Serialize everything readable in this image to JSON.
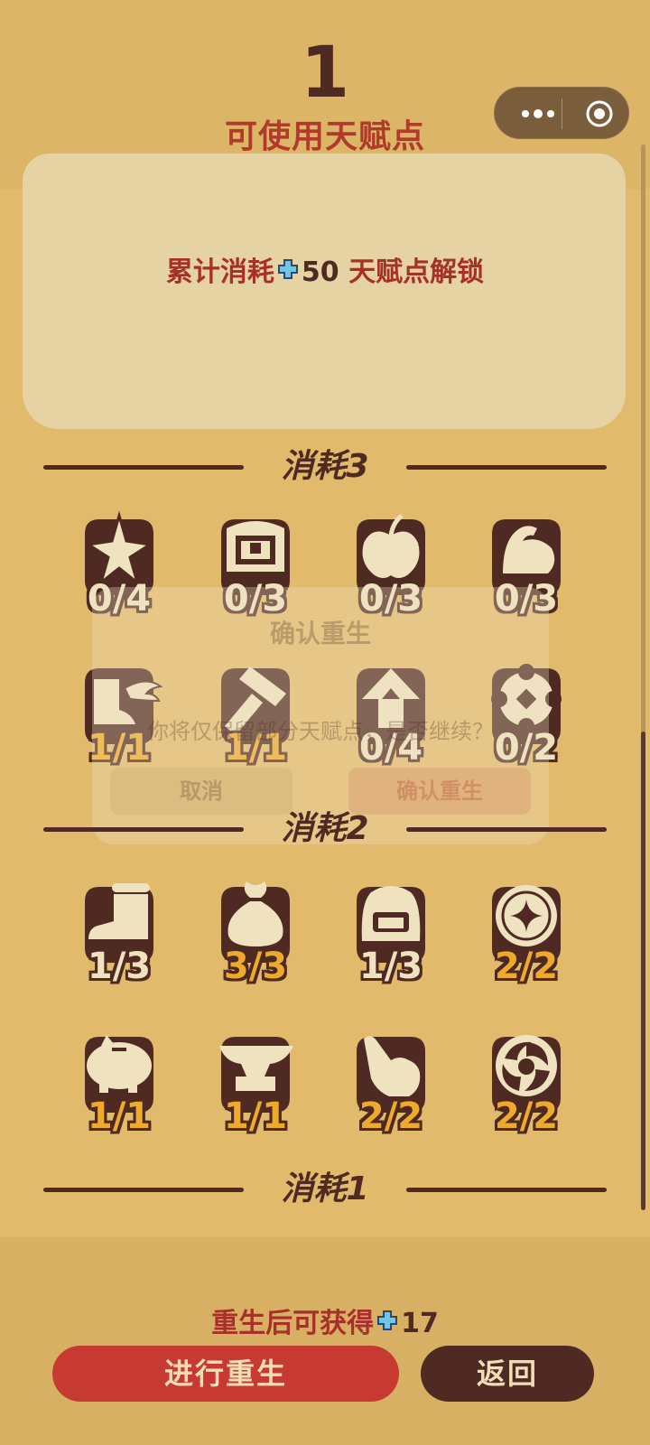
{
  "header": {
    "points_value": "1",
    "points_label": "可使用天赋点"
  },
  "unlock": {
    "prefix": "累计消耗",
    "amount": "50",
    "suffix": "天赋点解锁"
  },
  "tiers": [
    {
      "title": "消耗3",
      "talents": [
        {
          "icon": "sparkle-star-icon",
          "count": "0/4",
          "full": false
        },
        {
          "icon": "treasure-chest-icon",
          "count": "0/3",
          "full": false
        },
        {
          "icon": "apple-icon",
          "count": "0/3",
          "full": false
        },
        {
          "icon": "flexed-arm-icon",
          "count": "0/3",
          "full": false
        },
        {
          "icon": "winged-boot-icon",
          "count": "1/1",
          "full": true
        },
        {
          "icon": "hammer-icon",
          "count": "1/1",
          "full": true
        },
        {
          "icon": "up-arrow-icon",
          "count": "0/4",
          "full": false
        },
        {
          "icon": "gear-flower-icon",
          "count": "0/2",
          "full": false
        }
      ]
    },
    {
      "title": "消耗2",
      "talents": [
        {
          "icon": "boot-icon",
          "count": "1/3",
          "full": false
        },
        {
          "icon": "money-bag-icon",
          "count": "3/3",
          "full": true
        },
        {
          "icon": "backpack-icon",
          "count": "1/3",
          "full": false
        },
        {
          "icon": "coin-icon",
          "count": "2/2",
          "full": true
        },
        {
          "icon": "piggy-bank-icon",
          "count": "1/1",
          "full": true
        },
        {
          "icon": "anvil-icon",
          "count": "1/1",
          "full": true
        },
        {
          "icon": "pointing-hand-icon",
          "count": "2/2",
          "full": true
        },
        {
          "icon": "swirl-portal-icon",
          "count": "2/2",
          "full": true
        }
      ]
    },
    {
      "title": "消耗1",
      "talents": []
    }
  ],
  "dialog": {
    "title": "确认重生",
    "body": "你将仅保留部分天赋点，是否继续？",
    "cancel": "取消",
    "confirm": "确认重生"
  },
  "footer": {
    "gain_prefix": "重生后可获得",
    "gain_amount": "17",
    "rebirth_label": "进行重生",
    "back_label": "返回"
  },
  "colors": {
    "background": "#e2ba6c",
    "dark_brown": "#4e2a22",
    "red": "#b03a2c",
    "maxed_gold": "#eeaa2c",
    "parchment": "#e6d3a4"
  }
}
